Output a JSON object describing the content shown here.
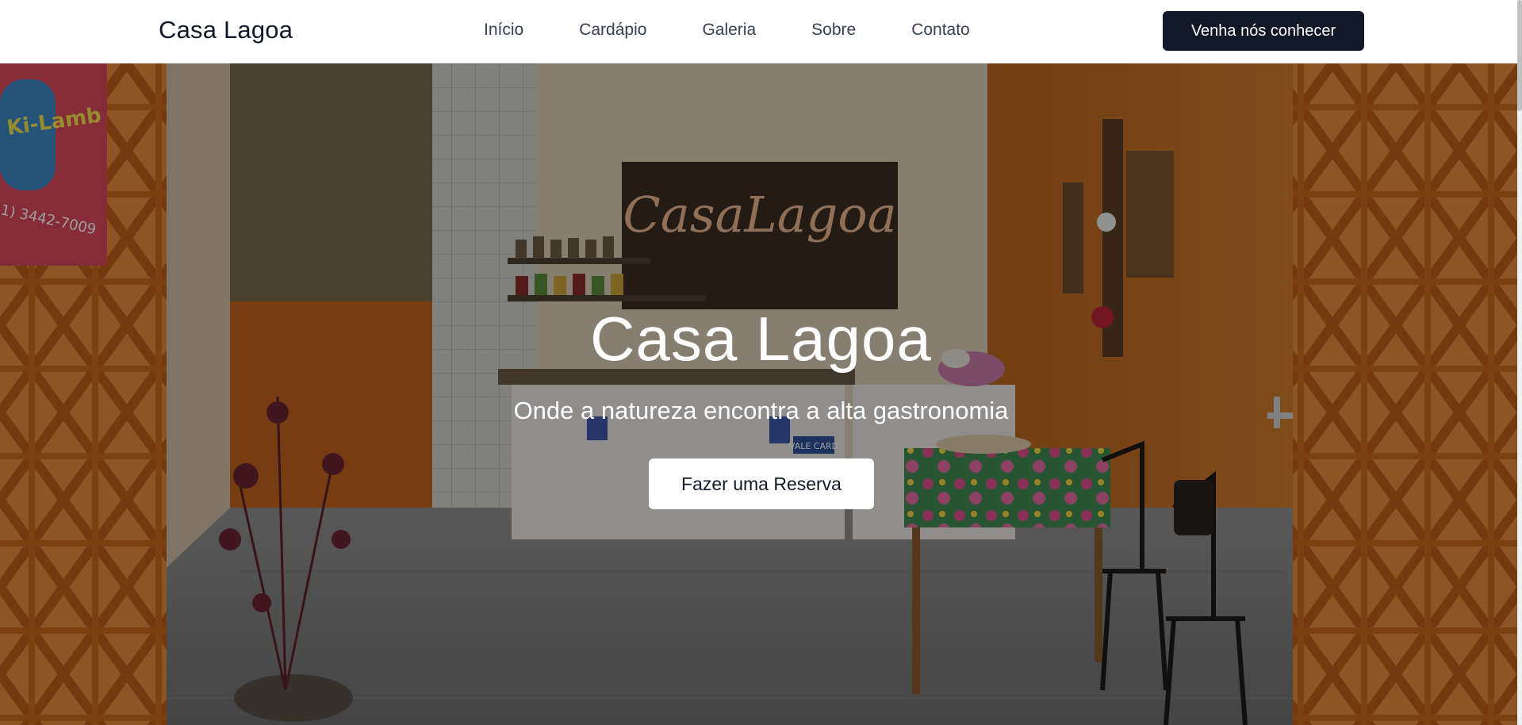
{
  "header": {
    "brand": "Casa Lagoa",
    "nav": [
      {
        "label": "Início"
      },
      {
        "label": "Cardápio"
      },
      {
        "label": "Galeria"
      },
      {
        "label": "Sobre"
      },
      {
        "label": "Contato"
      }
    ],
    "cta_label": "Venha nós conhecer"
  },
  "hero": {
    "title": "Casa Lagoa",
    "subtitle": "Onde a natureza encontra a alta gastronomia",
    "cta_label": "Fazer uma Reserva",
    "image": {
      "sign_text": "CasaLagoa",
      "poster_text": "Ki-Lamb",
      "poster_phone": "1) 3442-7009",
      "card_text": "VALE CARD"
    }
  },
  "colors": {
    "header_bg": "#ffffff",
    "brand_text": "#111827",
    "nav_text": "#374151",
    "cta_bg": "#111827",
    "cta_text": "#ffffff",
    "hero_accent_orange": "#c8641e"
  }
}
